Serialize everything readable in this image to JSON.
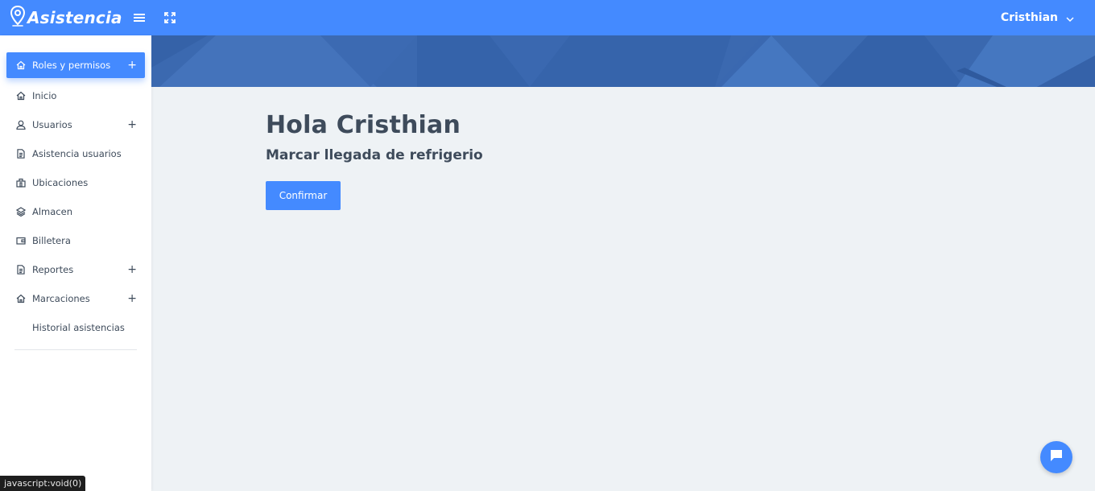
{
  "brand": {
    "name": "Asistencia",
    "logo_icon": "map-pin-icon"
  },
  "topbar": {
    "menu_icon": "hamburger-icon",
    "fullscreen_icon": "expand-icon",
    "user_name": "Cristhian",
    "user_chevron_icon": "chevron-down-icon"
  },
  "sidebar": {
    "items": [
      {
        "label": "Roles y permisos",
        "icon": "home-icon",
        "expandable": true,
        "active": true
      },
      {
        "label": "Inicio",
        "icon": "home-icon",
        "expandable": false
      },
      {
        "label": "Usuarios",
        "icon": "user-icon",
        "expandable": true
      },
      {
        "label": "Asistencia usuarios",
        "icon": "document-icon",
        "expandable": false
      },
      {
        "label": "Ubicaciones",
        "icon": "building-icon",
        "expandable": false
      },
      {
        "label": "Almacen",
        "icon": "layers-icon",
        "expandable": false
      },
      {
        "label": "Billetera",
        "icon": "wallet-icon",
        "expandable": false
      },
      {
        "label": "Reportes",
        "icon": "document-icon",
        "expandable": true
      },
      {
        "label": "Marcaciones",
        "icon": "home-icon",
        "expandable": true
      },
      {
        "label": "Historial asistencias",
        "icon": "",
        "expandable": false
      }
    ],
    "expand_glyph": "+"
  },
  "main": {
    "greeting": "Hola Cristhian",
    "subtitle": "Marcar llegada de refrigerio",
    "confirm_label": "Confirmar"
  },
  "chat": {
    "icon": "chat-icon"
  },
  "status_bar": {
    "text": "javascript:void(0)"
  },
  "colors": {
    "primary": "#448aff",
    "banner": "#3d6cb3",
    "background": "#eef2f5",
    "text": "#3e4b5b"
  }
}
